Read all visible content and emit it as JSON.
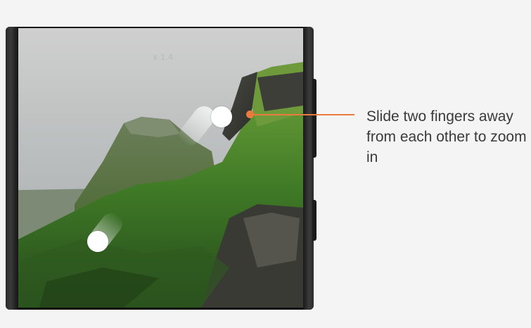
{
  "screen": {
    "zoom_indicator": "x 1.4"
  },
  "gesture": {
    "type": "pinch-out",
    "fingers": 2
  },
  "callout": {
    "text": "Slide two fingers away from each other to zoom in",
    "accent_color": "#e97b3c"
  },
  "icons": [
    "finger-touch-icon",
    "finger-touch-icon"
  ]
}
